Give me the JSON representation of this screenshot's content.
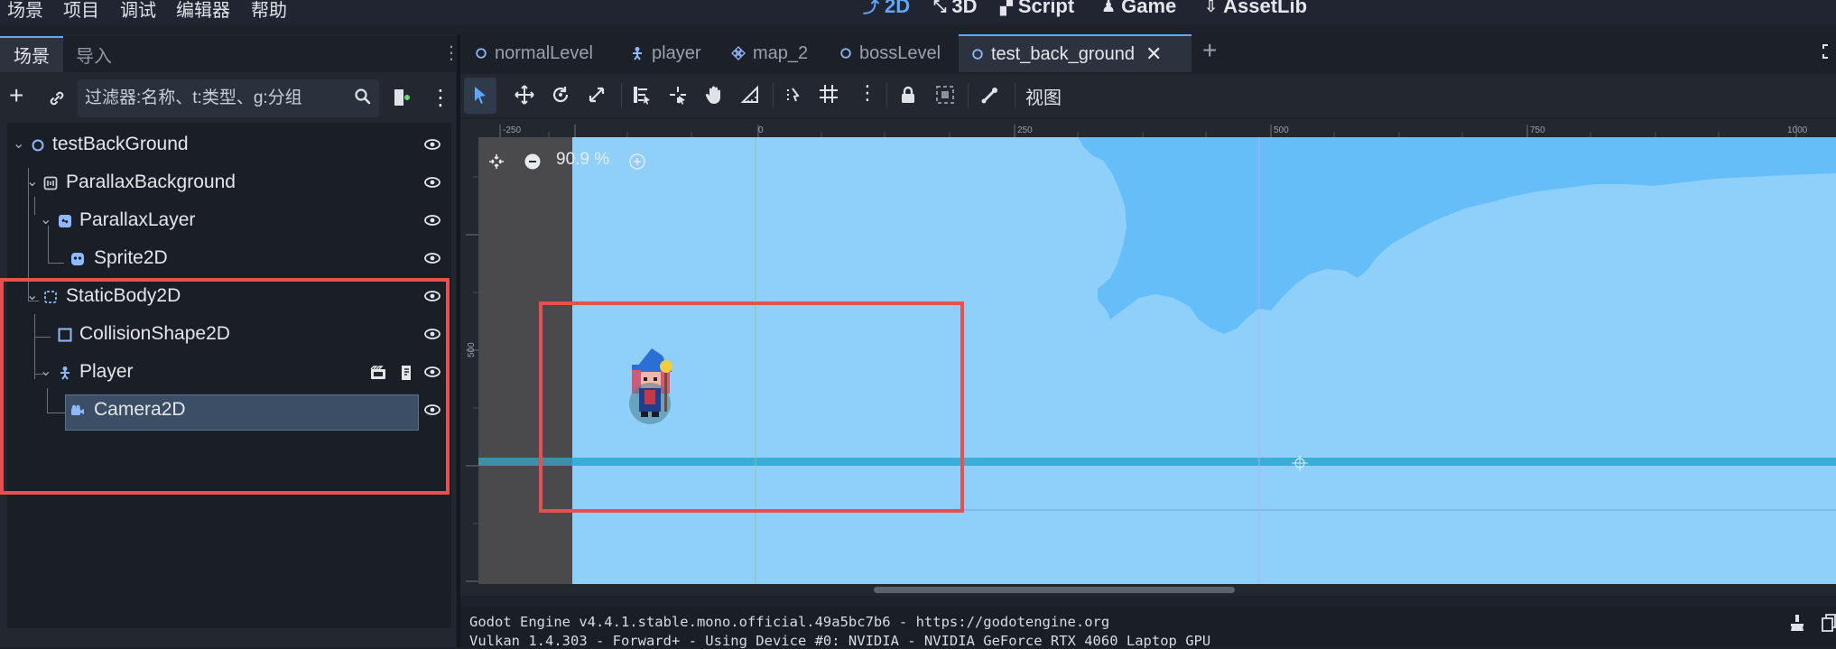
{
  "menubar": {
    "items": [
      "场景",
      "项目",
      "调试",
      "编辑器",
      "帮助"
    ],
    "workspaces": [
      {
        "label": "2D",
        "icon": "2d-icon",
        "active": true
      },
      {
        "label": "3D",
        "icon": "3d-icon",
        "active": false
      },
      {
        "label": "Script",
        "icon": "script-icon",
        "active": false
      },
      {
        "label": "Game",
        "icon": "game-icon",
        "active": false
      },
      {
        "label": "AssetLib",
        "icon": "assetlib-icon",
        "active": false
      }
    ]
  },
  "dock": {
    "tabs": [
      "场景",
      "导入"
    ],
    "filter_placeholder": "过滤器:名称、t:类型、g:分组"
  },
  "tree": [
    {
      "label": "testBackGround",
      "icon": "node2d-icon"
    },
    {
      "label": "ParallaxBackground",
      "icon": "parallax-background-icon"
    },
    {
      "label": "ParallaxLayer",
      "icon": "parallax-layer-icon"
    },
    {
      "label": "Sprite2D",
      "icon": "sprite2d-icon"
    },
    {
      "label": "StaticBody2D",
      "icon": "static-body-icon"
    },
    {
      "label": "CollisionShape2D",
      "icon": "collision-shape-icon"
    },
    {
      "label": "Player",
      "icon": "character-body-icon"
    },
    {
      "label": "Camera2D",
      "icon": "camera2d-icon",
      "selected": true
    }
  ],
  "scene_tabs": [
    {
      "label": "normalLevel",
      "icon": "node2d-icon"
    },
    {
      "label": "player",
      "icon": "character-body-icon"
    },
    {
      "label": "map_2",
      "icon": "tilemap-icon"
    },
    {
      "label": "bossLevel",
      "icon": "node2d-icon"
    },
    {
      "label": "test_back_ground",
      "icon": "node2d-icon",
      "active": true
    }
  ],
  "viewport": {
    "view_menu_label": "视图",
    "zoom": "90.9 %",
    "ruler_h": [
      "-250",
      "0",
      "250",
      "500",
      "750",
      "1000"
    ],
    "ruler_v": [
      "500"
    ]
  },
  "output": {
    "lines": [
      "Godot Engine v4.4.1.stable.mono.official.49a5bc7b6 - https://godotengine.org",
      "Vulkan 1.4.303 - Forward+ - Using Device #0: NVIDIA - NVIDIA GeForce RTX 4060 Laptop GPU"
    ]
  },
  "colors": {
    "accent": "#5fa7ff",
    "highlight": "#e65050",
    "sky": "#8fd0fb",
    "cloud": "#66bef8"
  }
}
